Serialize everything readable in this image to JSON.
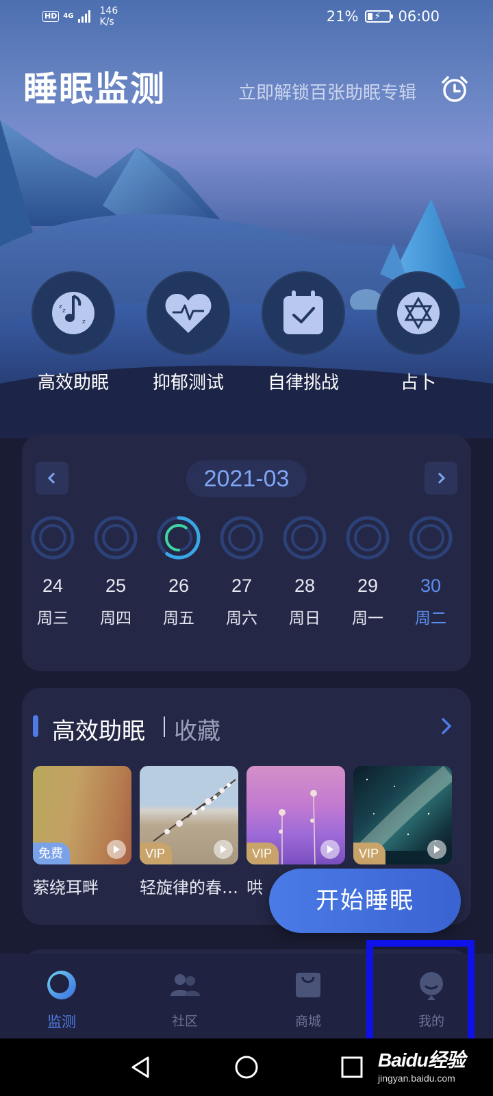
{
  "status_bar": {
    "hd": "HD",
    "network": "4G",
    "speed_value": "146",
    "speed_unit": "K/s",
    "battery": "21%",
    "time": "06:00"
  },
  "header": {
    "title": "睡眠监测",
    "unlock_text": "立即解锁百张助眠专辑",
    "alarm_icon": "alarm-clock-icon"
  },
  "quick_actions": [
    {
      "label": "高效助眠",
      "icon": "music-note-moon-icon"
    },
    {
      "label": "抑郁测试",
      "icon": "heart-pulse-icon"
    },
    {
      "label": "自律挑战",
      "icon": "calendar-check-icon"
    },
    {
      "label": "占卜",
      "icon": "hexagram-icon"
    }
  ],
  "calendar": {
    "month": "2021-03",
    "prev_icon": "chevron-left-icon",
    "next_icon": "chevron-right-icon",
    "days": [
      {
        "num": "24",
        "week": "周三",
        "progress": 0
      },
      {
        "num": "25",
        "week": "周四",
        "progress": 0
      },
      {
        "num": "26",
        "week": "周五",
        "progress": 0.6
      },
      {
        "num": "27",
        "week": "周六",
        "progress": 0
      },
      {
        "num": "28",
        "week": "周日",
        "progress": 0
      },
      {
        "num": "29",
        "week": "周一",
        "progress": 0
      },
      {
        "num": "30",
        "week": "周二",
        "progress": 0
      }
    ],
    "selected_index": 6
  },
  "playlist": {
    "title": "高效助眠",
    "favorites": "收藏",
    "items": [
      {
        "name": "萦绕耳畔",
        "badge": "免费"
      },
      {
        "name": "轻旋律的春…",
        "badge": "VIP"
      },
      {
        "name": "哄",
        "badge": "VIP"
      },
      {
        "name": "",
        "badge": "VIP"
      }
    ]
  },
  "start_button": "开始睡眠",
  "bottom_nav": [
    {
      "label": "监测",
      "icon": "moon-icon",
      "active": true
    },
    {
      "label": "社区",
      "icon": "community-icon",
      "active": false
    },
    {
      "label": "商城",
      "icon": "shopping-bag-icon",
      "active": false
    },
    {
      "label": "我的",
      "icon": "profile-icon",
      "active": false
    }
  ],
  "watermark": {
    "main": "Baidu经验",
    "sub": "jingyan.baidu.com"
  },
  "colors": {
    "accent": "#4e7ee8",
    "card": "#242846",
    "highlight": "#0f12e8",
    "ring_progress": "#3fd6a3"
  }
}
